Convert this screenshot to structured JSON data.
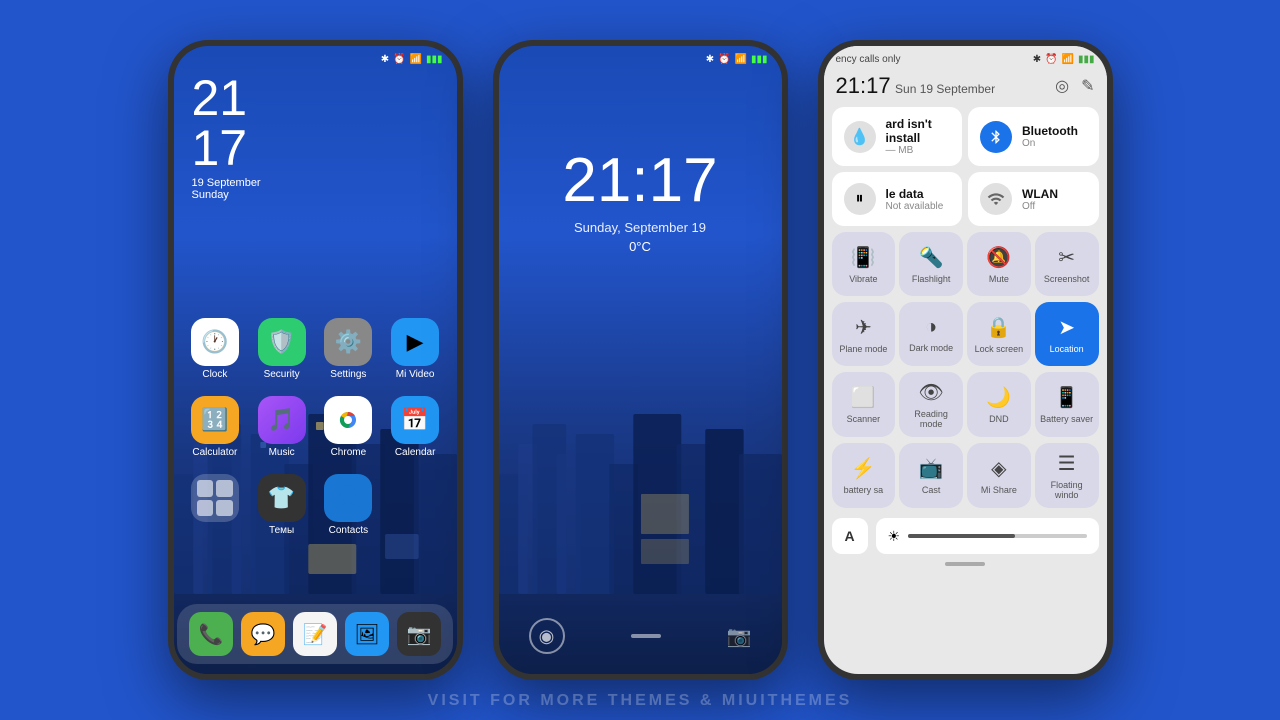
{
  "background_color": "#2255cc",
  "watermark": "VISIT FOR MORE THEMES & MIUITHEMES",
  "phone1": {
    "type": "homescreen",
    "status_bar": {
      "bluetooth": "✱",
      "alarm": "⏰",
      "signal": "📶",
      "battery": "🔋"
    },
    "time_line1": "21",
    "time_line2": "17",
    "date_line1": "19 September",
    "date_line2": "Sunday",
    "apps_row1": [
      {
        "label": "Clock",
        "icon": "🕐",
        "color": "clock"
      },
      {
        "label": "Security",
        "icon": "🛡",
        "color": "security"
      },
      {
        "label": "Settings",
        "icon": "⚙",
        "color": "settings"
      },
      {
        "label": "Mi Video",
        "icon": "▶",
        "color": "mivideo"
      }
    ],
    "apps_row2": [
      {
        "label": "Calculator",
        "icon": "🔢",
        "color": "calculator"
      },
      {
        "label": "Music",
        "icon": "🎵",
        "color": "music"
      },
      {
        "label": "Chrome",
        "icon": "⊙",
        "color": "chrome"
      },
      {
        "label": "Calendar",
        "icon": "📅",
        "color": "calendar"
      }
    ],
    "apps_row3": [
      {
        "label": "Темы",
        "icon": "👕",
        "color": "themes"
      },
      {
        "label": "Contacts",
        "icon": "👤",
        "color": "contacts"
      }
    ],
    "dock": [
      {
        "label": "Phone",
        "icon": "📞",
        "color": "phone"
      },
      {
        "label": "Messages",
        "icon": "💬",
        "color": "messages"
      },
      {
        "label": "Notes",
        "icon": "📝",
        "color": "notes"
      },
      {
        "label": "Gallery",
        "icon": "🖼",
        "color": "gallery"
      },
      {
        "label": "Camera",
        "icon": "📷",
        "color": "camera"
      }
    ]
  },
  "phone2": {
    "type": "lockscreen",
    "time": "21:17",
    "date": "Sunday, September 19",
    "temperature": "0°C"
  },
  "phone3": {
    "type": "controlcenter",
    "status_text": "ency calls only",
    "time": "21:17",
    "date_day": "Sun",
    "date_full": "19 September",
    "tiles": [
      {
        "icon": "💧",
        "title": "ard isn't install",
        "subtitle": "— MB",
        "active": false
      },
      {
        "icon": "bluetooth",
        "title": "Bluetooth",
        "subtitle": "On",
        "active": true
      },
      {
        "icon": "pause",
        "title": "le data",
        "subtitle": "Not available",
        "active": false
      },
      {
        "icon": "wifi",
        "title": "WLAN",
        "subtitle": "Off",
        "active": false
      }
    ],
    "icon_grid_row1": [
      {
        "icon": "📳",
        "label": "Vibrate",
        "active": false
      },
      {
        "icon": "🔦",
        "label": "Flashlight",
        "active": false
      },
      {
        "icon": "🔔",
        "label": "Mute",
        "active": false
      },
      {
        "icon": "✂",
        "label": "Screenshot",
        "active": false
      }
    ],
    "icon_grid_row2": [
      {
        "icon": "✈",
        "label": "Plane mode",
        "active": false
      },
      {
        "icon": "◑",
        "label": "Dark mode",
        "active": false
      },
      {
        "icon": "🔒",
        "label": "Lock screen",
        "active": false
      },
      {
        "icon": "➤",
        "label": "Location",
        "active": true
      }
    ],
    "icon_grid_row3": [
      {
        "icon": "⬜",
        "label": "Scanner",
        "active": false
      },
      {
        "icon": "👁",
        "label": "Reading mode",
        "active": false
      },
      {
        "icon": "🌙",
        "label": "DND",
        "active": false
      },
      {
        "icon": "📱",
        "label": "Battery saver",
        "active": false
      }
    ],
    "icon_grid_row4": [
      {
        "icon": "⚡",
        "label": "battery sa",
        "active": false
      },
      {
        "icon": "📺",
        "label": "Cast",
        "active": false
      },
      {
        "icon": "◈",
        "label": "Mi Share",
        "active": false
      },
      {
        "icon": "☰",
        "label": "Floating windo",
        "active": false
      }
    ],
    "brightness": 60,
    "text_size_label": "A"
  }
}
